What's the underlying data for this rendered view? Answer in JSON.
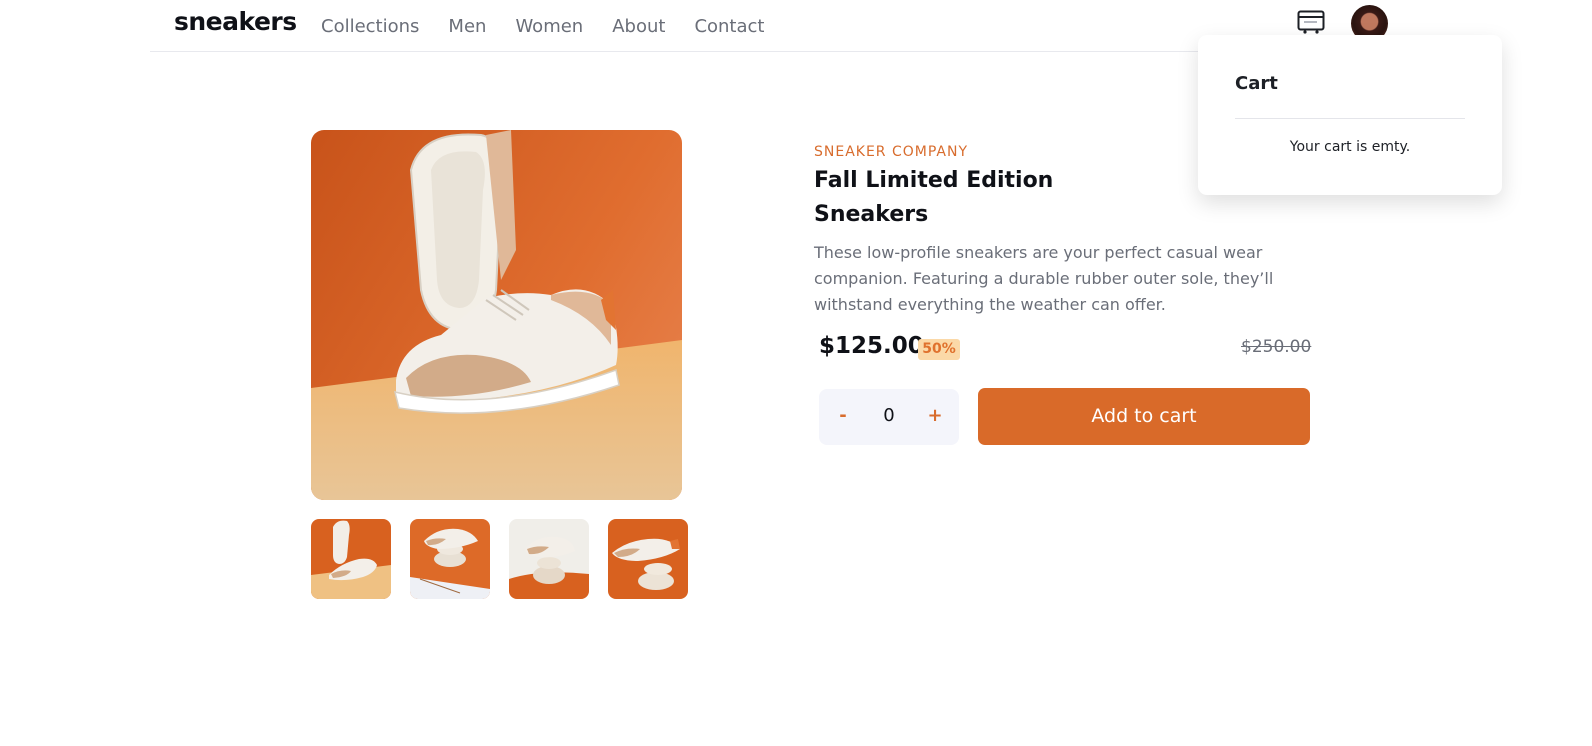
{
  "header": {
    "logo": "sneakers",
    "nav": [
      "Collections",
      "Men",
      "Women",
      "About",
      "Contact"
    ],
    "cart_icon": "cart-icon",
    "avatar": "user-avatar"
  },
  "cart": {
    "title": "Cart",
    "empty_message": "Your cart is emty."
  },
  "product": {
    "brand": "SNEAKER COMPANY",
    "name": "Fall Limited Edition Sneakers",
    "description": "These low-profile sneakers are your perfect casual wear companion. Featuring a durable rubber outer sole, they’ll withstand everything the weather can offer.",
    "price": "$125.00",
    "discount": "50%",
    "original_price": "$250.00",
    "quantity": {
      "minus": "-",
      "value": "0",
      "plus": "+"
    },
    "add_to_cart": "Add to cart",
    "images": [
      "product-image-1",
      "product-image-2",
      "product-image-3",
      "product-image-4"
    ]
  },
  "colors": {
    "accent": "#d96a29",
    "discount_bg": "#fbd9a8",
    "text_dark": "#0f1117",
    "text_muted": "#6a6e78"
  }
}
